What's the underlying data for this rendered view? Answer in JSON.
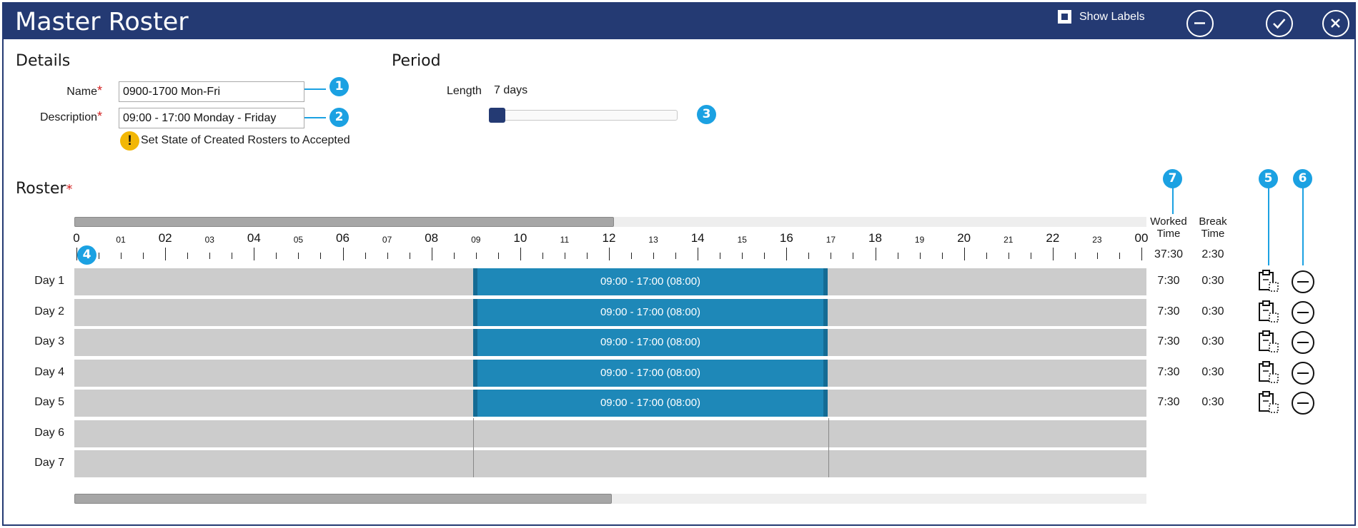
{
  "window": {
    "title": "Master Roster",
    "show_labels": "Show Labels",
    "show_labels_checked": true
  },
  "details": {
    "heading": "Details",
    "name_label": "Name",
    "name_value": "0900-1700 Mon-Fri",
    "description_label": "Description",
    "description_value": "09:00 - 17:00 Monday - Friday",
    "state_text": "Set State of Created Rosters to Accepted",
    "warning_glyph": "!"
  },
  "period": {
    "heading": "Period",
    "length_label": "Length",
    "length_value": "7 days"
  },
  "roster": {
    "heading": "Roster",
    "hours": [
      "0",
      "01",
      "02",
      "03",
      "04",
      "05",
      "06",
      "07",
      "08",
      "09",
      "10",
      "11",
      "12",
      "13",
      "14",
      "15",
      "16",
      "17",
      "18",
      "19",
      "20",
      "21",
      "22",
      "23",
      "00"
    ],
    "worked_header": "Worked\nTime",
    "break_header": "Break\nTime",
    "total_worked": "37:30",
    "total_break": "2:30",
    "rows": [
      {
        "day": "Day 1",
        "shift": "09:00 - 17:00 (08:00)",
        "worked": "7:30",
        "break": "0:30"
      },
      {
        "day": "Day 2",
        "shift": "09:00 - 17:00 (08:00)",
        "worked": "7:30",
        "break": "0:30"
      },
      {
        "day": "Day 3",
        "shift": "09:00 - 17:00 (08:00)",
        "worked": "7:30",
        "break": "0:30"
      },
      {
        "day": "Day 4",
        "shift": "09:00 - 17:00 (08:00)",
        "worked": "7:30",
        "break": "0:30"
      },
      {
        "day": "Day 5",
        "shift": "09:00 - 17:00 (08:00)",
        "worked": "7:30",
        "break": "0:30"
      },
      {
        "day": "Day 6",
        "shift": "",
        "worked": "",
        "break": ""
      },
      {
        "day": "Day 7",
        "shift": "",
        "worked": "",
        "break": ""
      }
    ]
  },
  "callouts": [
    "1",
    "2",
    "3",
    "4",
    "5",
    "6",
    "7"
  ],
  "colors": {
    "titlebar": "#243a73",
    "shift_block": "#1e88b8",
    "callout": "#1ba1e2",
    "warning": "#f2b705",
    "required": "#d21f1f"
  },
  "icons": {
    "minimize": "minus-circle-icon",
    "accept": "check-circle-icon",
    "close": "close-circle-icon",
    "paste": "clipboard-paste-icon",
    "remove": "remove-circle-icon"
  }
}
